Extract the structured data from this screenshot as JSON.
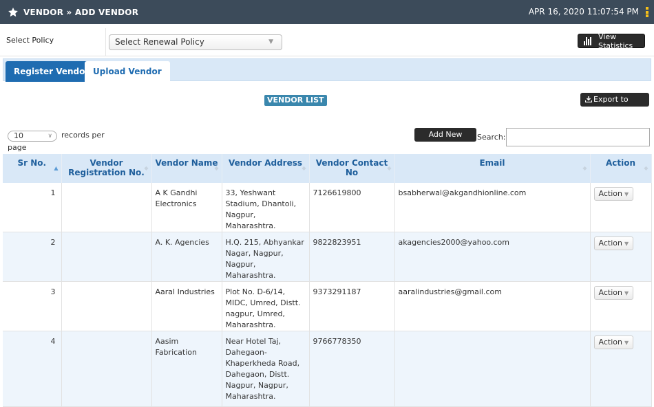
{
  "header": {
    "title": "VENDOR » ADD VENDOR",
    "datetime": "APR 16, 2020 11:07:54 PM"
  },
  "policy": {
    "label": "Select Policy",
    "select_value": "Select Renewal Policy",
    "stats_button": "View Statistics"
  },
  "tabs": [
    {
      "label": "Register Vendor",
      "active": true
    },
    {
      "label": "Upload Vendor",
      "active": false
    }
  ],
  "list": {
    "label": "VENDOR LIST",
    "export_button": "Export to Excel",
    "length_value": "10",
    "length_text1": "records per",
    "length_text2": "page",
    "add_button": "Add New Vendor",
    "search_label": "Search:",
    "search_value": ""
  },
  "table": {
    "columns": [
      "Sr No.",
      "Vendor Registration No.",
      "Vendor Name",
      "Vendor Address",
      "Vendor Contact No",
      "Email",
      "Action"
    ],
    "rows": [
      {
        "sr": "1",
        "reg": "",
        "name": "A K Gandhi Electronics",
        "address": "33, Yeshwant Stadium, Dhantoli, Nagpur, Maharashtra.",
        "contact": "7126619800",
        "email": "bsabherwal@akgandhionline.com",
        "action": "Action"
      },
      {
        "sr": "2",
        "reg": "",
        "name": "A. K. Agencies",
        "address": "H.Q. 215, Abhyankar Nagar, Nagpur, Nagpur, Maharashtra.",
        "contact": "9822823951",
        "email": "akagencies2000@yahoo.com",
        "action": "Action"
      },
      {
        "sr": "3",
        "reg": "",
        "name": "Aaral Industries",
        "address": "Plot No. D-6/14, MIDC, Umred, Distt. nagpur, Umred, Maharashtra.",
        "contact": "9373291187",
        "email": "aaralindustries@gmail.com",
        "action": "Action"
      },
      {
        "sr": "4",
        "reg": "",
        "name": "Aasim Fabrication",
        "address": "Near Hotel Taj, Dahegaon-Khaperkheda Road, Dahegaon, Distt. Nagpur, Nagpur, Maharashtra.",
        "contact": "9766778350",
        "email": "",
        "action": "Action"
      }
    ]
  },
  "colors": {
    "titlebar": "#3c4b5a",
    "accent": "#1f6cb1",
    "table_header": "#d9e8f7",
    "label_badge": "#3a87ad",
    "dark_button": "#2b2b2b"
  },
  "icons": {
    "title": "star-icon",
    "menu": "kebab-menu-icon",
    "stats": "bar-chart-icon",
    "export": "download-tray-icon"
  }
}
